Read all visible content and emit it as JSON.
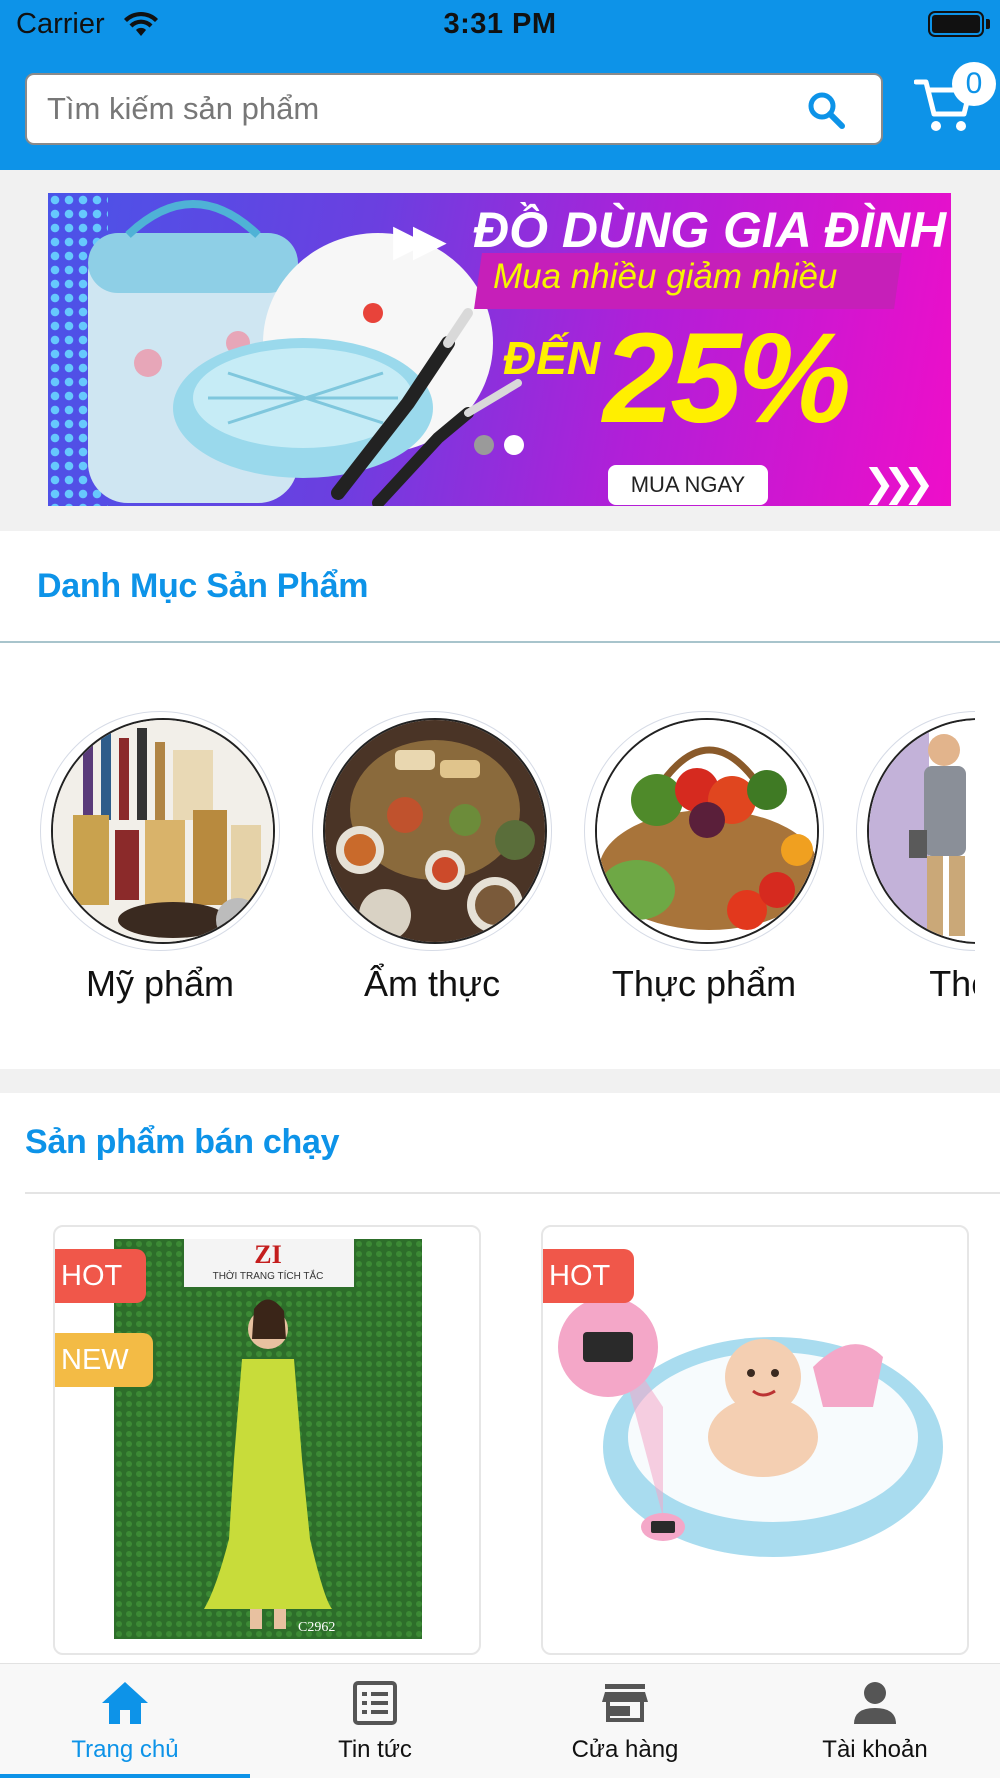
{
  "status_bar": {
    "carrier": "Carrier",
    "time": "3:31 PM"
  },
  "header": {
    "search_placeholder": "Tìm kiếm sản phẩm",
    "cart_count": "0",
    "brand_color": "#0d93e8"
  },
  "banner": {
    "title": "ĐỒ DÙNG GIA ĐÌNH",
    "subtitle": "Mua nhiều giảm nhiều",
    "prefix": "ĐẾN",
    "discount": "25%",
    "cta": "MUA NGAY",
    "slide_count": 2,
    "active_slide": 2
  },
  "categories": {
    "title": "Danh Mục Sản Phẩm",
    "items": [
      {
        "label": "Mỹ phẩm"
      },
      {
        "label": "Ẩm thực"
      },
      {
        "label": "Thực phẩm"
      },
      {
        "label": "Thời t"
      }
    ]
  },
  "best_sellers": {
    "title": "Sản phẩm bán chạy",
    "products": [
      {
        "badges": [
          "HOT",
          "NEW"
        ],
        "image_text": "THỜI TRANG TÍCH TẮC",
        "code": "C2962"
      },
      {
        "badges": [
          "HOT"
        ]
      }
    ],
    "badge_colors": {
      "HOT": "#f0574a",
      "NEW": "#f3bb45"
    }
  },
  "bottom_nav": {
    "items": [
      {
        "label": "Trang chủ",
        "icon": "home-icon",
        "active": true
      },
      {
        "label": "Tin tức",
        "icon": "news-icon",
        "active": false
      },
      {
        "label": "Cửa hàng",
        "icon": "store-icon",
        "active": false
      },
      {
        "label": "Tài khoản",
        "icon": "account-icon",
        "active": false
      }
    ]
  }
}
